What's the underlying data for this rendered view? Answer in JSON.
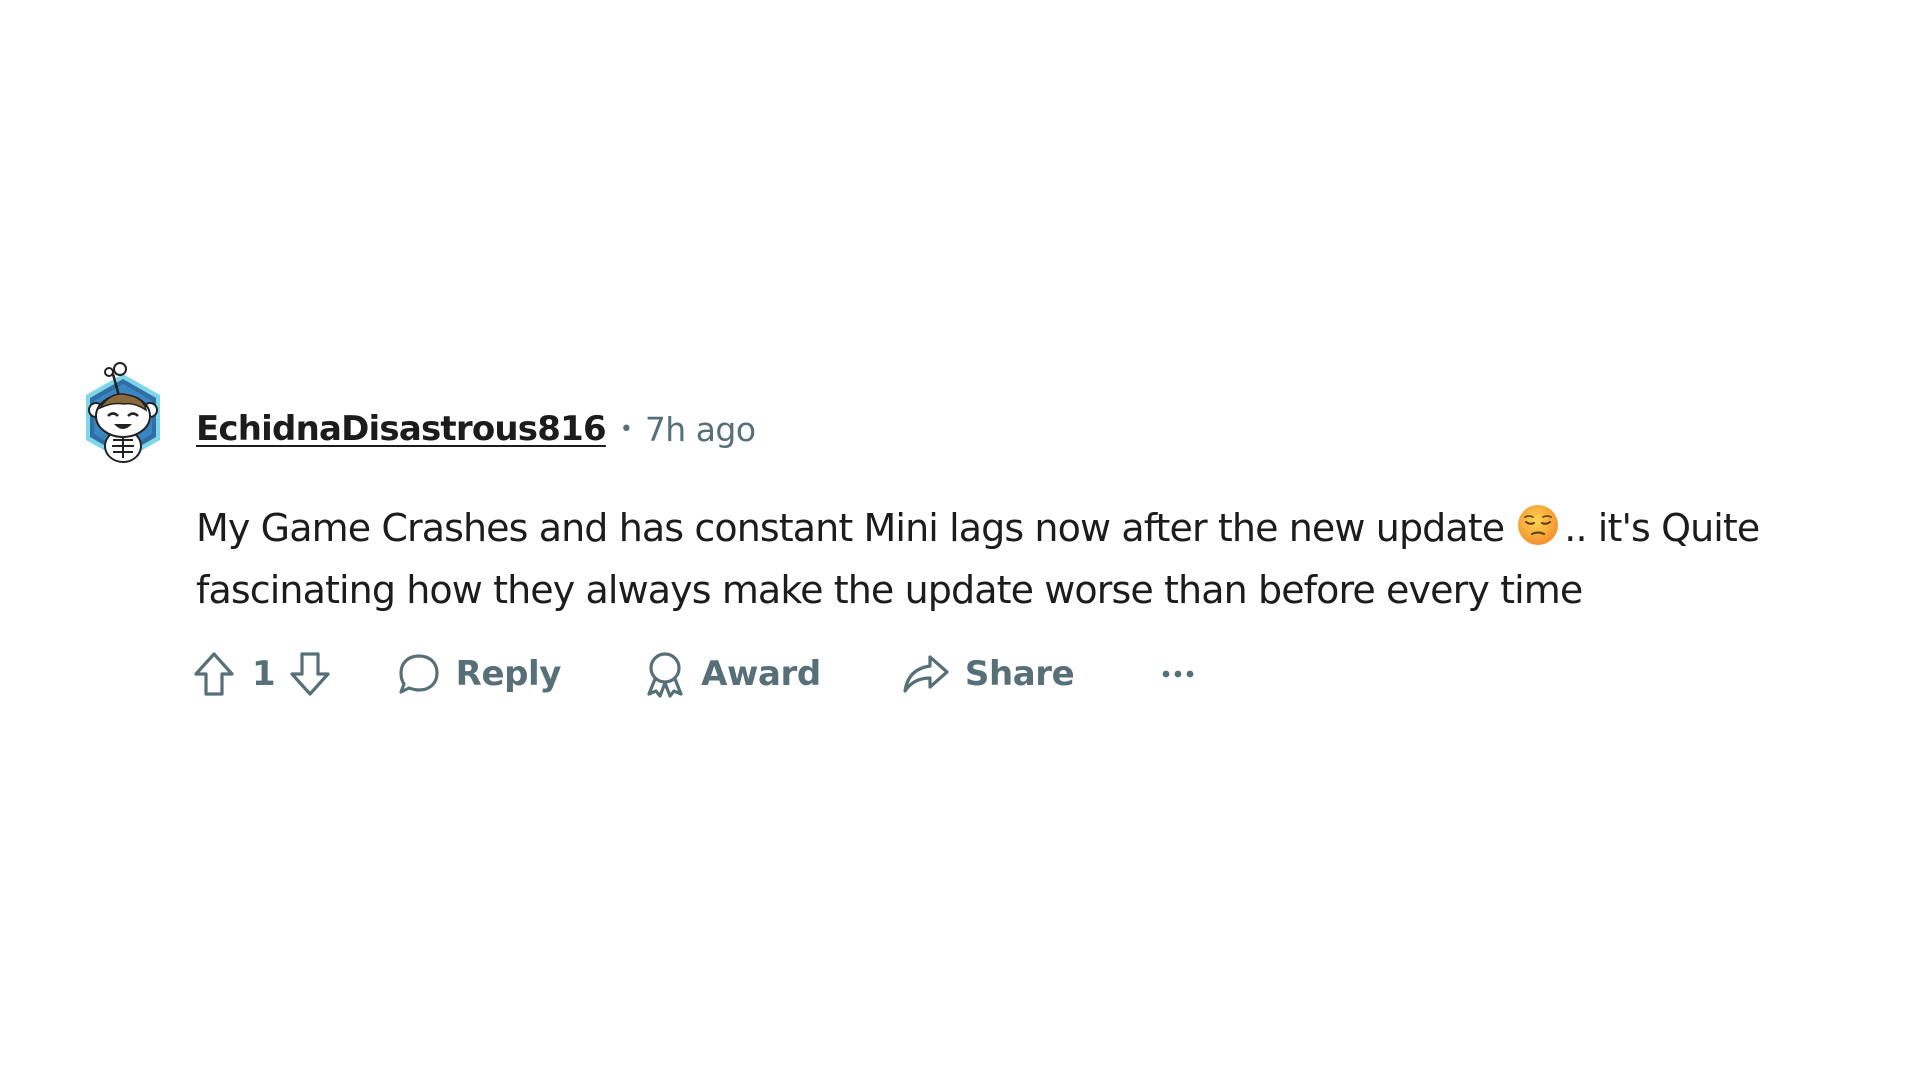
{
  "comment": {
    "author": "EchidnaDisastrous816",
    "separator": "•",
    "timestamp": "7h ago",
    "text_before_emoji": "My Game Crashes and has constant Mini lags now after the new update",
    "emoji": "pensive-face",
    "text_after_emoji": ".. it's Quite fascinating how they always make the update worse than before every time",
    "avatar_icon": "snoo-avatar-icon"
  },
  "actions": {
    "vote_count": "1",
    "reply_label": "Reply",
    "award_label": "Award",
    "share_label": "Share",
    "more_label": "···"
  },
  "colors": {
    "text": "#1c1c1c",
    "muted": "#576f76",
    "avatar_hex": "#2a8fbf"
  }
}
